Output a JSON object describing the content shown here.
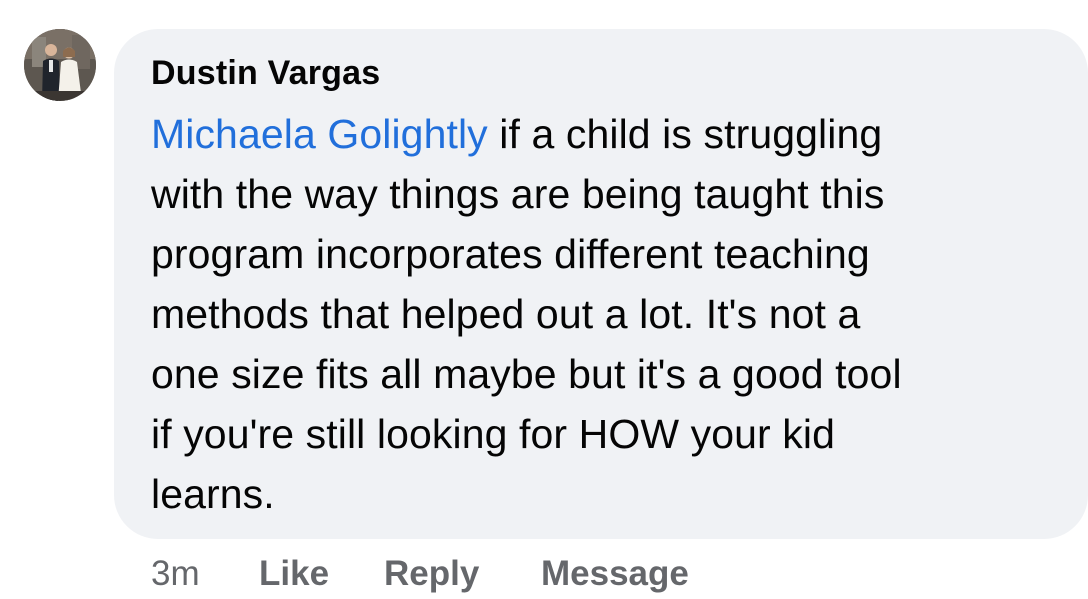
{
  "comment": {
    "author": "Dustin Vargas",
    "mention": "Michaela Golightly",
    "lines": [
      " if a child is struggling",
      "with the way things are being taught this",
      "program incorporates different teaching",
      "methods that helped out a lot. It's not a",
      "one size fits all maybe but it's a good tool",
      "if you're still looking for HOW your kid",
      "learns."
    ],
    "timestamp": "3m",
    "actions": {
      "like": "Like",
      "reply": "Reply",
      "message": "Message"
    }
  },
  "colors": {
    "bubble": "#f0f2f5",
    "mention": "#216fdb",
    "secondary_text": "#65676b"
  }
}
